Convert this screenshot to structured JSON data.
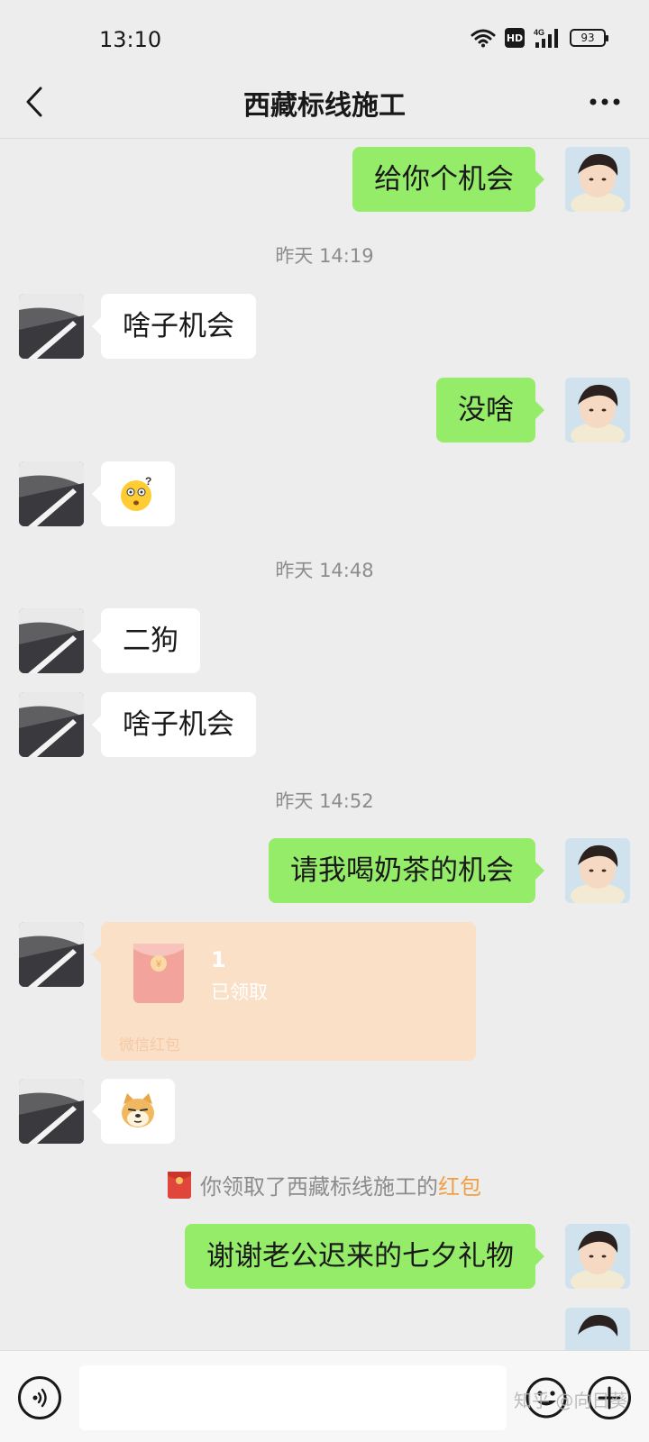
{
  "status_bar": {
    "time": "13:10",
    "hd_label": "HD",
    "network": "4G",
    "battery": "93"
  },
  "nav": {
    "title": "西藏标线施工",
    "back_icon": "chevron-left-icon",
    "more_icon": "more-dots-icon"
  },
  "messages": [
    {
      "side": "out",
      "text": "给你个机会"
    },
    {
      "timestamp": "昨天 14:19"
    },
    {
      "side": "in",
      "text": "啥子机会"
    },
    {
      "side": "out",
      "text": "没啥"
    },
    {
      "side": "in",
      "sticker": "confused-face-emoji"
    },
    {
      "timestamp": "昨天 14:48"
    },
    {
      "side": "in",
      "text": "二狗"
    },
    {
      "side": "in",
      "text": "啥子机会"
    },
    {
      "timestamp": "昨天 14:52"
    },
    {
      "side": "out",
      "text": "请我喝奶茶的机会"
    },
    {
      "side": "in",
      "red_packet": {
        "amount": "1",
        "status": "已领取",
        "footer": "微信红包"
      }
    },
    {
      "side": "in",
      "sticker": "doge-emoji"
    },
    {
      "system": {
        "prefix": "你领取了西藏标线施工的",
        "link": "红包"
      }
    },
    {
      "side": "out",
      "text": "谢谢老公迟来的七夕礼物"
    }
  ],
  "input_bar": {
    "placeholder": "",
    "voice_icon": "voice-icon",
    "emoji_icon": "emoji-icon",
    "plus_icon": "plus-icon"
  },
  "watermark": "知乎 @向日葵",
  "colors": {
    "background": "#ededed",
    "outgoing_bubble": "#95ec69",
    "incoming_bubble": "#ffffff",
    "red_packet": "#fbe0c8",
    "link": "#f0a043"
  }
}
